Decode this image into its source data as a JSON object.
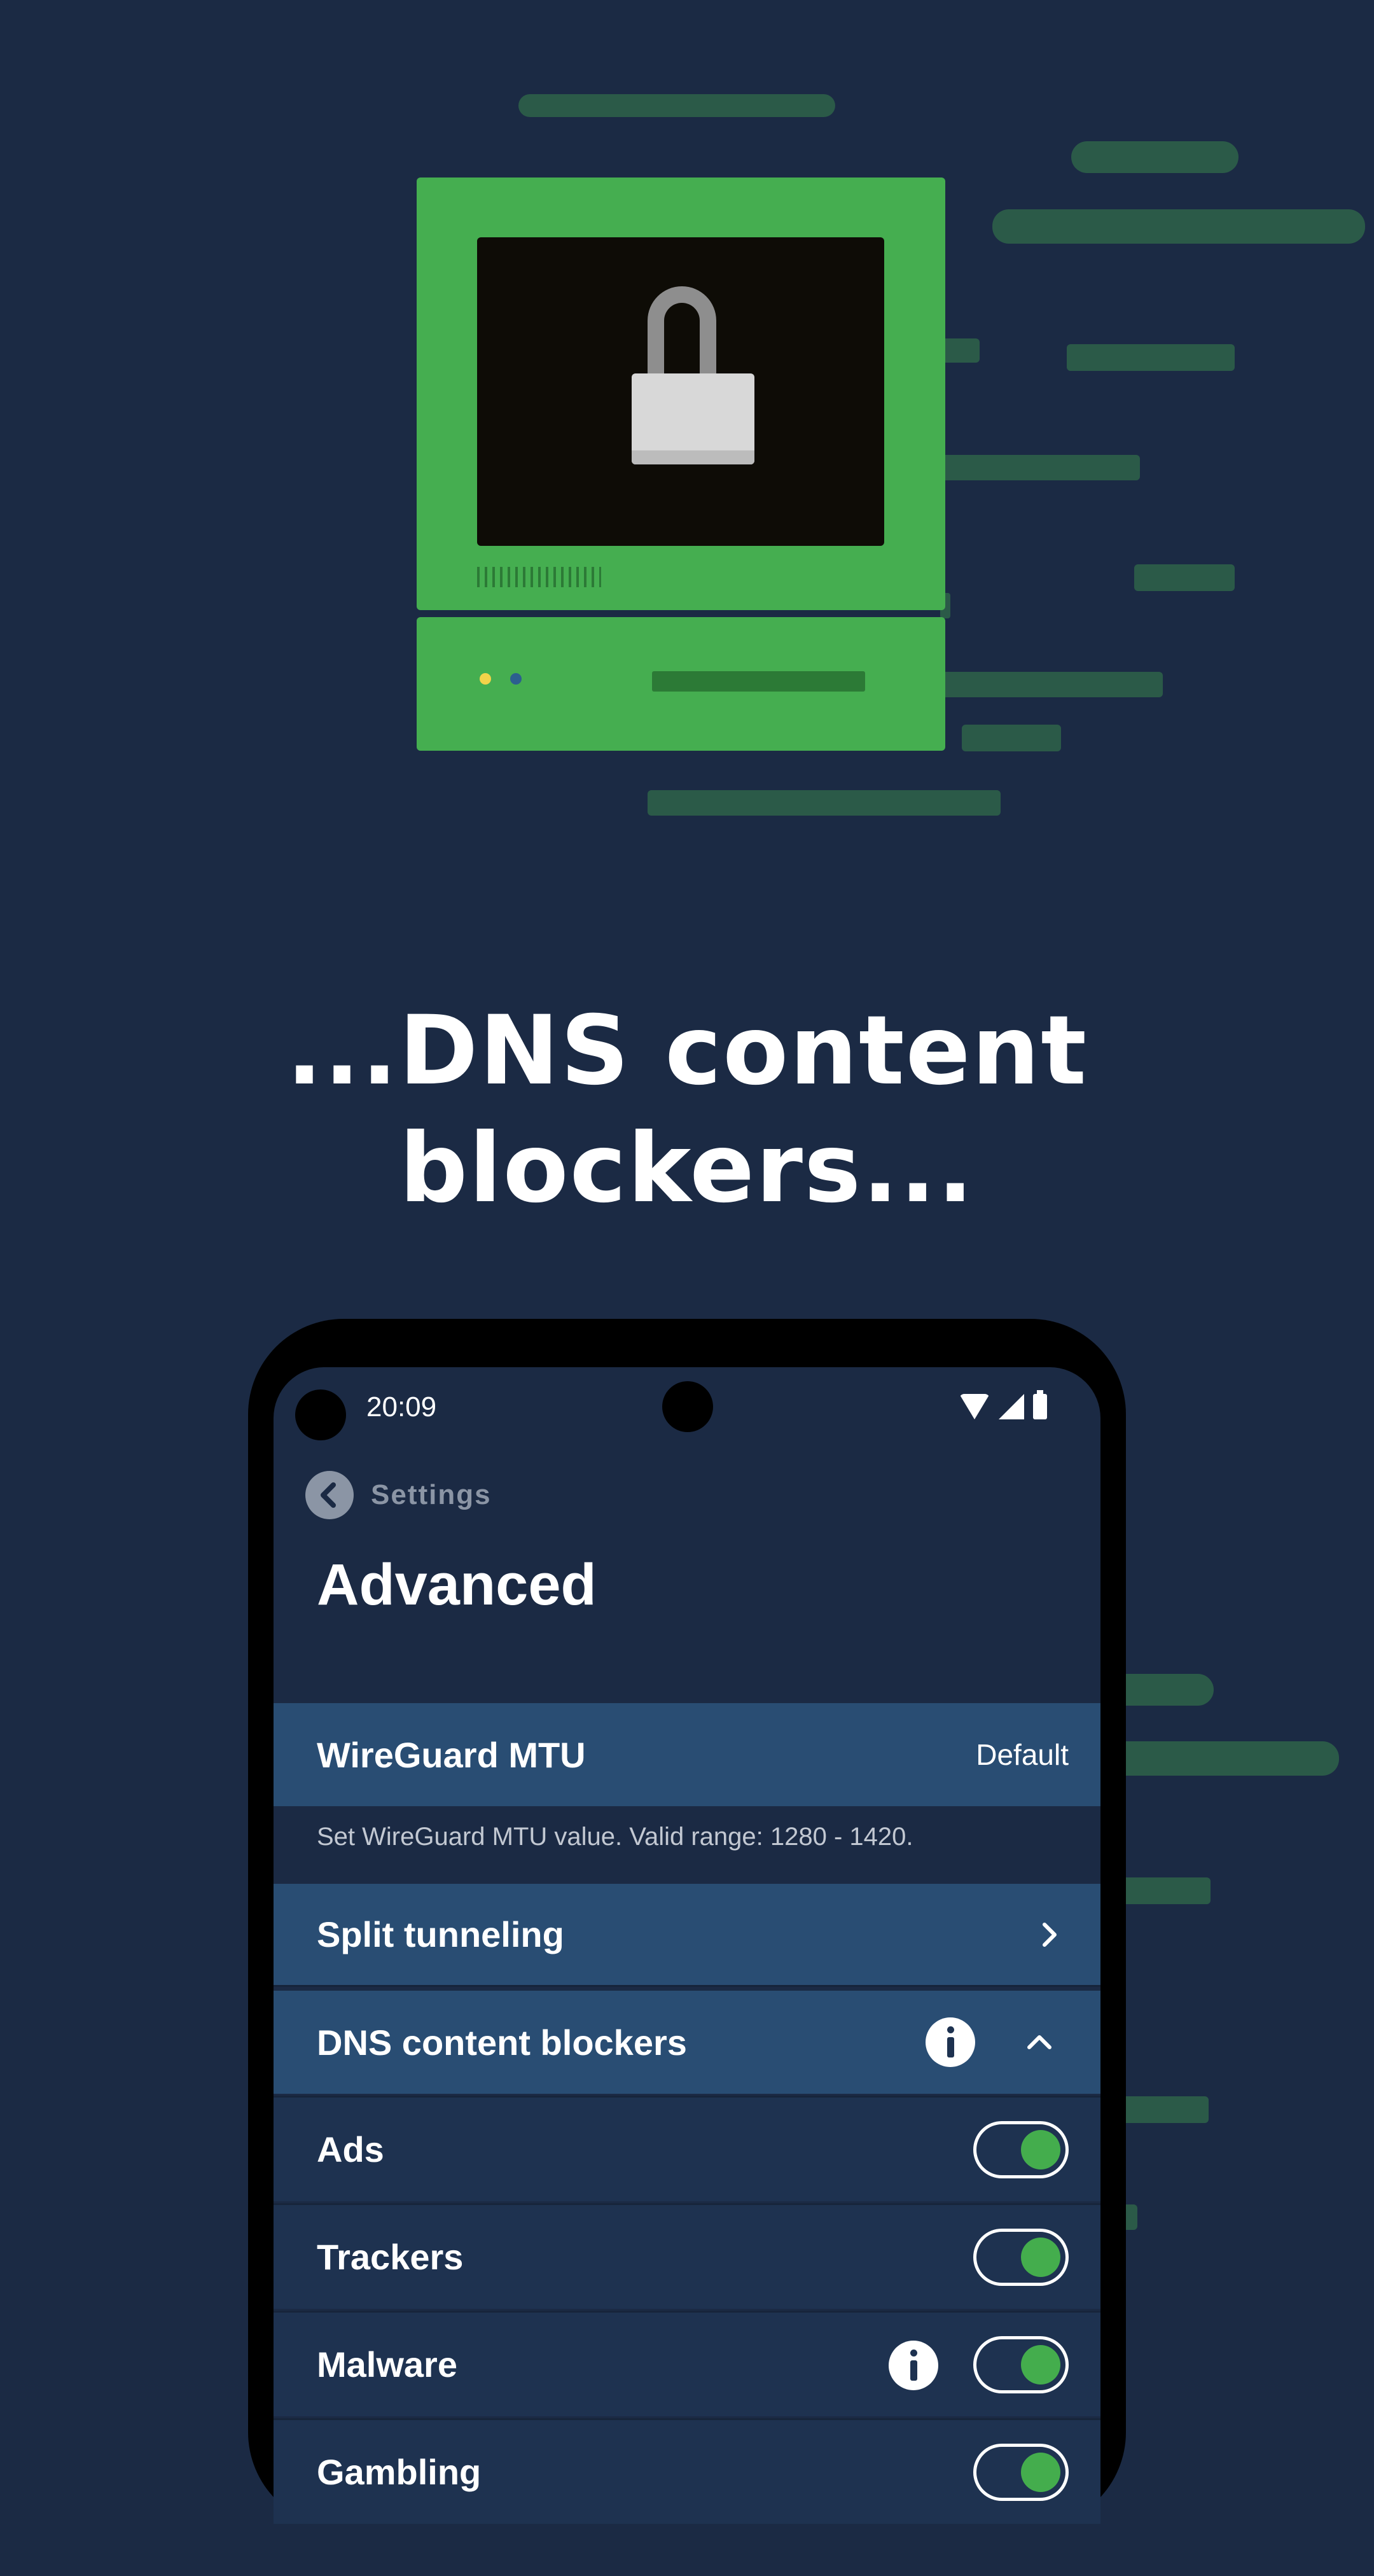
{
  "headline": {
    "line1": "...DNS content",
    "line2": "blockers..."
  },
  "illustration": {
    "icon": "padlock-icon",
    "colors": {
      "background": "#1b2a44",
      "computer": "#45ae50",
      "screen": "#0e0c06",
      "streaks": "#2b5a48"
    }
  },
  "status_bar": {
    "time": "20:09",
    "icons": [
      "wifi-icon",
      "cellular-signal-icon",
      "battery-icon"
    ]
  },
  "nav": {
    "back_icon": "chevron-left-icon",
    "back_label": "Settings"
  },
  "page": {
    "title": "Advanced"
  },
  "settings": {
    "mtu": {
      "label": "WireGuard MTU",
      "value": "Default",
      "description": "Set WireGuard MTU value. Valid range: 1280 - 1420."
    },
    "split_tunneling": {
      "label": "Split tunneling",
      "icon": "chevron-right-icon"
    },
    "dns_blockers": {
      "label": "DNS content blockers",
      "icons": [
        "info-icon",
        "chevron-up-icon"
      ],
      "items": [
        {
          "label": "Ads",
          "enabled": true,
          "info": false
        },
        {
          "label": "Trackers",
          "enabled": true,
          "info": false
        },
        {
          "label": "Malware",
          "enabled": true,
          "info": true
        },
        {
          "label": "Gambling",
          "enabled": true,
          "info": false
        }
      ]
    }
  },
  "colors": {
    "header_row": "#294d73",
    "sub_row": "#1e3250",
    "toggle_on": "#44ad4d"
  }
}
